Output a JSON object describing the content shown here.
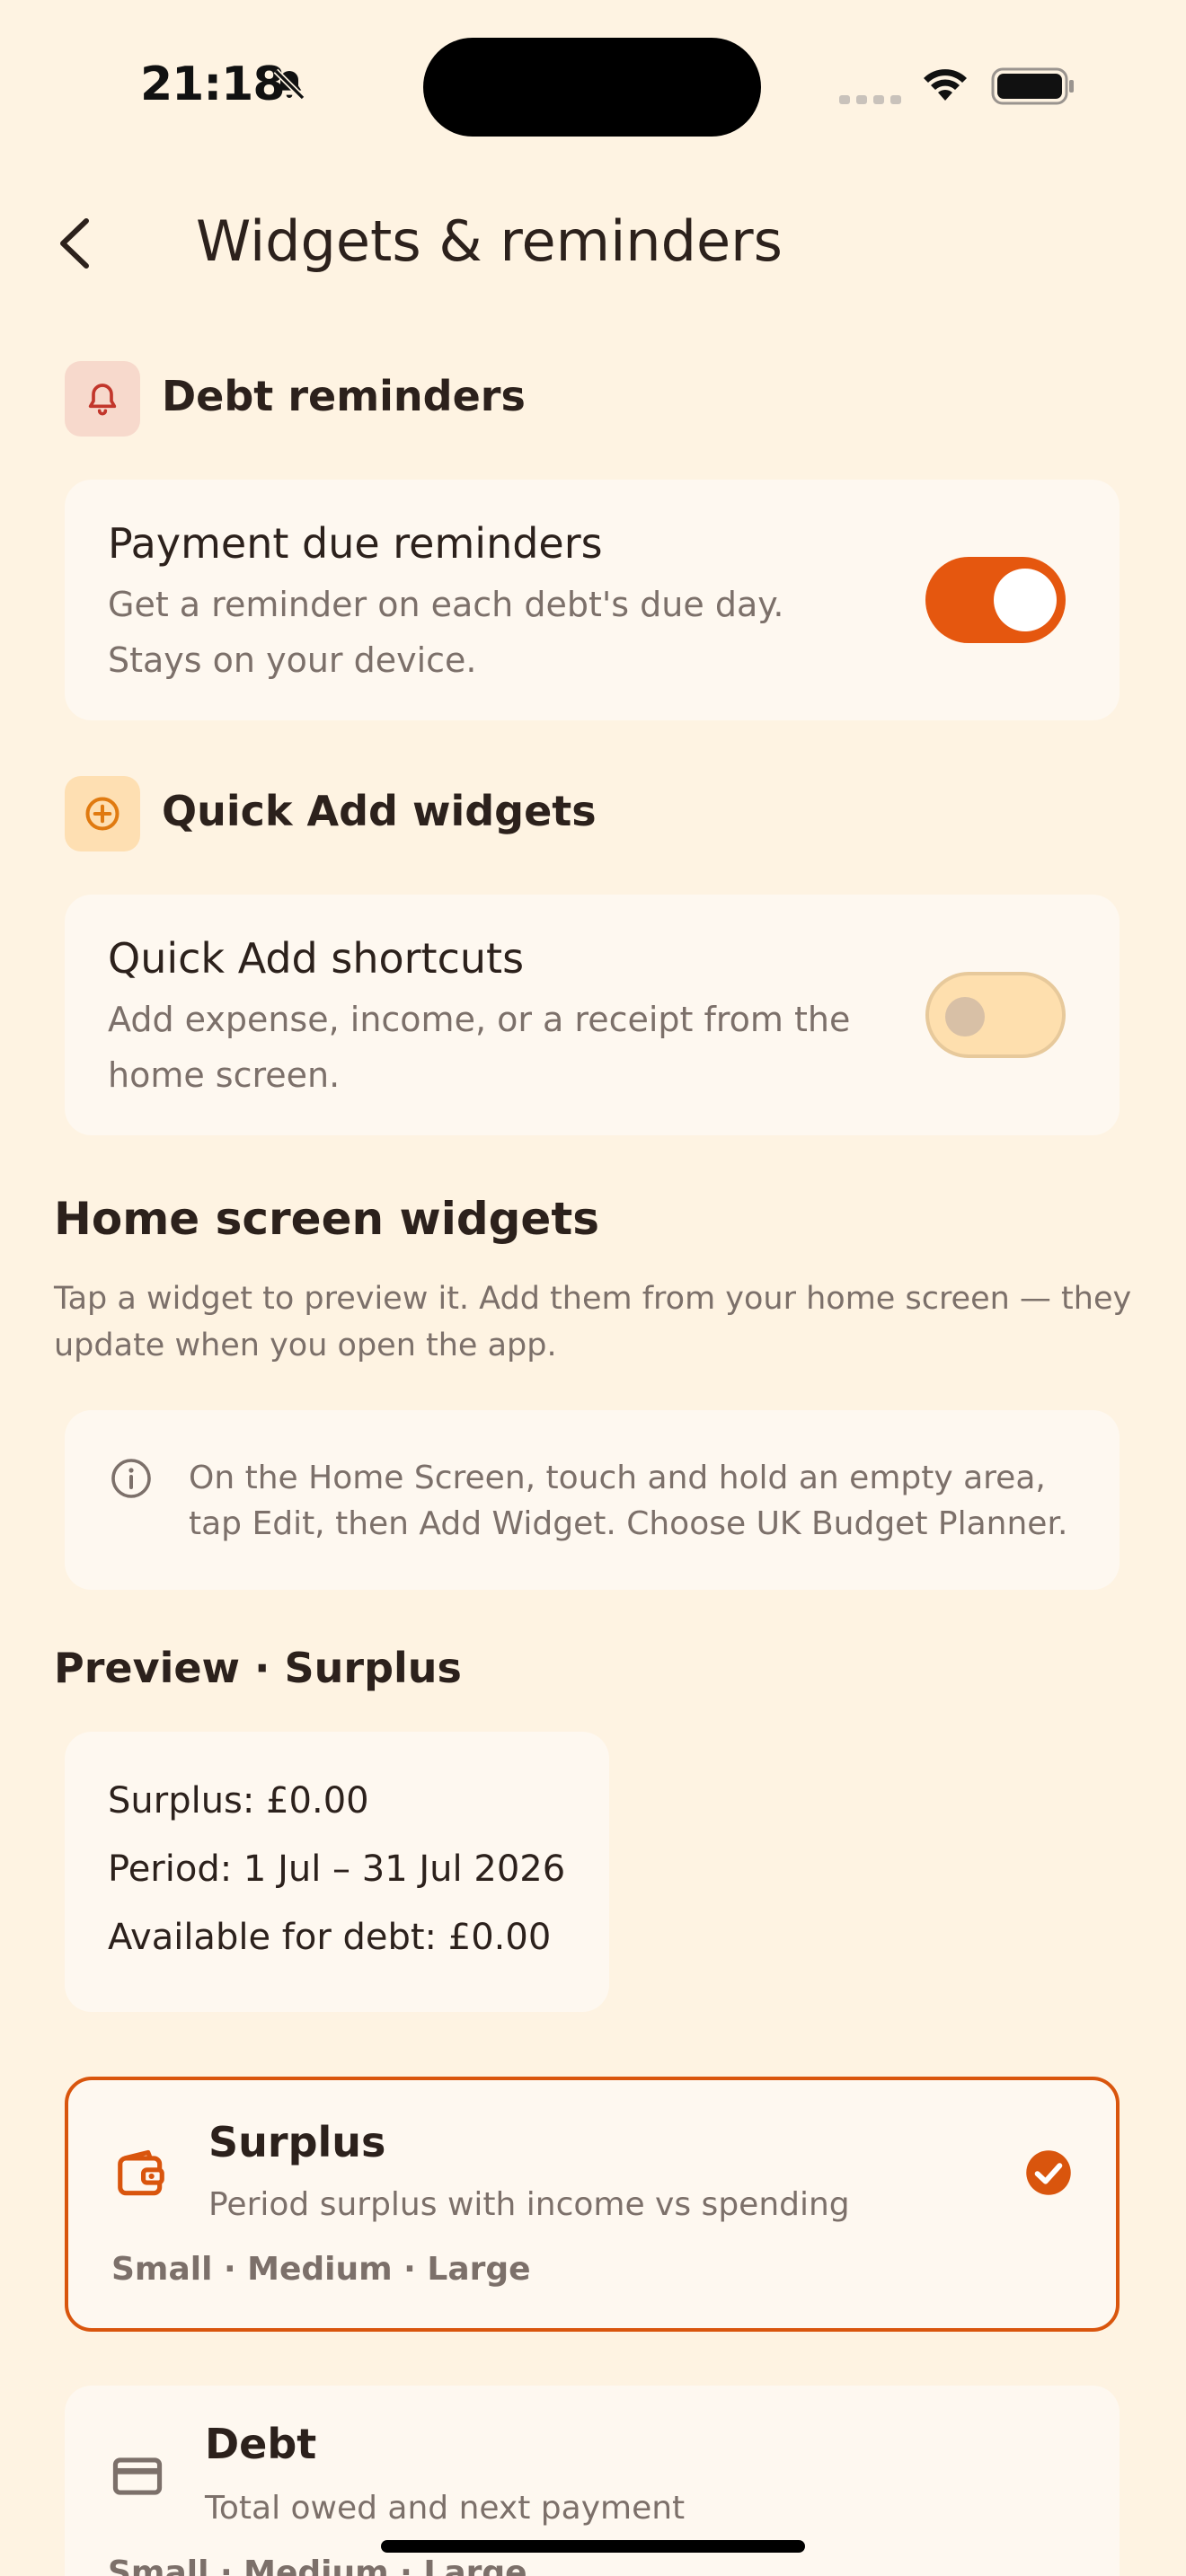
{
  "status_bar": {
    "time": "21:18",
    "icons": [
      "bell-slash-icon",
      "cellular-signal-icon",
      "wifi-icon",
      "battery-icon"
    ]
  },
  "header": {
    "back_icon": "chevron-left-icon",
    "title": "Widgets & reminders"
  },
  "debt_reminders": {
    "icon": "bell-icon",
    "heading": "Debt reminders",
    "setting": {
      "title": "Payment due reminders",
      "description": "Get a reminder on each debt's due day. Stays on your device.",
      "enabled": true
    }
  },
  "quick_add": {
    "icon": "plus-circle-icon",
    "heading": "Quick Add widgets",
    "setting": {
      "title": "Quick Add shortcuts",
      "description": "Add expense, income, or a receipt from the home screen.",
      "enabled": false
    }
  },
  "home_widgets": {
    "heading": "Home screen widgets",
    "description": "Tap a widget to preview it. Add them from your home screen — they update when you open the app.",
    "info_icon": "info-circle-icon",
    "info": "On the Home Screen, touch and hold an empty area, tap Edit, then Add Widget. Choose UK Budget Planner."
  },
  "preview": {
    "heading": "Preview · Surplus",
    "lines": [
      "Surplus: £0.00",
      "Period: 1 Jul – 31 Jul 2026",
      "Available for debt: £0.00"
    ]
  },
  "widgets": [
    {
      "icon": "wallet-icon",
      "title": "Surplus",
      "description": "Period surplus with income vs spending",
      "sizes": "Small · Medium · Large",
      "selected": true
    },
    {
      "icon": "credit-card-icon",
      "title": "Debt",
      "description": "Total owed and next payment",
      "sizes": "Small · Medium · Large",
      "selected": false
    }
  ],
  "colors": {
    "background": "#FEF3E2",
    "card": "#FEF8F0",
    "accent": "#E5570F",
    "text": "#2C211C",
    "muted": "#7C706A"
  }
}
